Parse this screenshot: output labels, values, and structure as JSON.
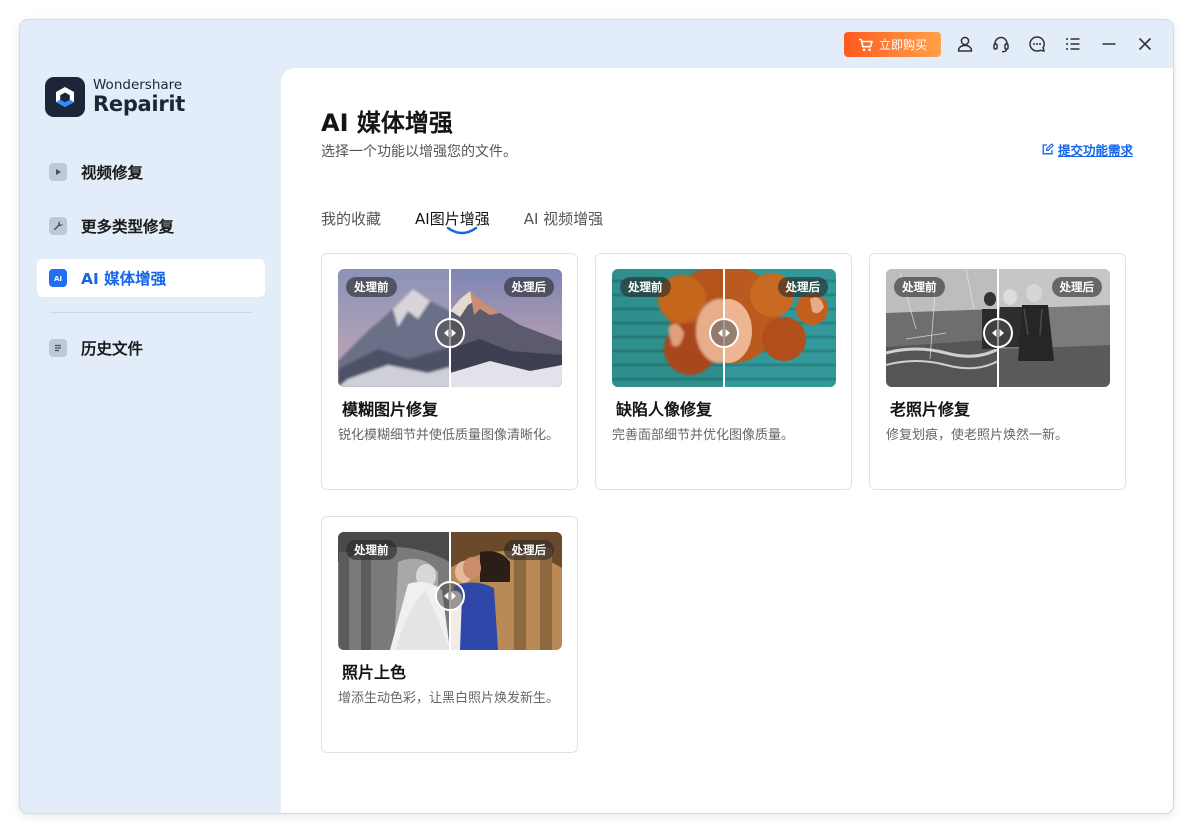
{
  "titlebar": {
    "buy_label": "立即购买",
    "icons": [
      "account-icon",
      "headset-icon",
      "chat-icon",
      "menu-icon",
      "minimize-icon",
      "close-icon"
    ]
  },
  "brand": {
    "line1": "Wondershare",
    "line2": "Repairit"
  },
  "sidebar": {
    "items": [
      {
        "label": "视频修复",
        "icon": "video-icon",
        "active": false
      },
      {
        "label": "更多类型修复",
        "icon": "wrench-icon",
        "active": false
      },
      {
        "label": "AI 媒体增强",
        "icon": "ai-icon",
        "active": true
      },
      {
        "label": "历史文件",
        "icon": "document-icon",
        "active": false
      }
    ]
  },
  "main": {
    "title": "AI 媒体增强",
    "subtitle": "选择一个功能以增强您的文件。",
    "request_link": "提交功能需求",
    "tabs": [
      {
        "label": "我的收藏",
        "active": false
      },
      {
        "label": "AI图片增强",
        "active": true
      },
      {
        "label": "AI 视频增强",
        "active": false
      }
    ],
    "badge_before": "处理前",
    "badge_after": "处理后",
    "cards": [
      {
        "title": "模糊图片修复",
        "desc": "锐化模糊细节并使低质量图像清晰化。"
      },
      {
        "title": "缺陷人像修复",
        "desc": "完善面部细节并优化图像质量。"
      },
      {
        "title": "老照片修复",
        "desc": "修复划痕，使老照片焕然一新。"
      },
      {
        "title": "照片上色",
        "desc": "增添生动色彩，让黑白照片焕发新生。"
      }
    ]
  },
  "colors": {
    "accent": "#1565e8",
    "buy_start": "#ff5a1f",
    "buy_end": "#ffa24a",
    "sidebar_bg": "#e2edf9"
  }
}
